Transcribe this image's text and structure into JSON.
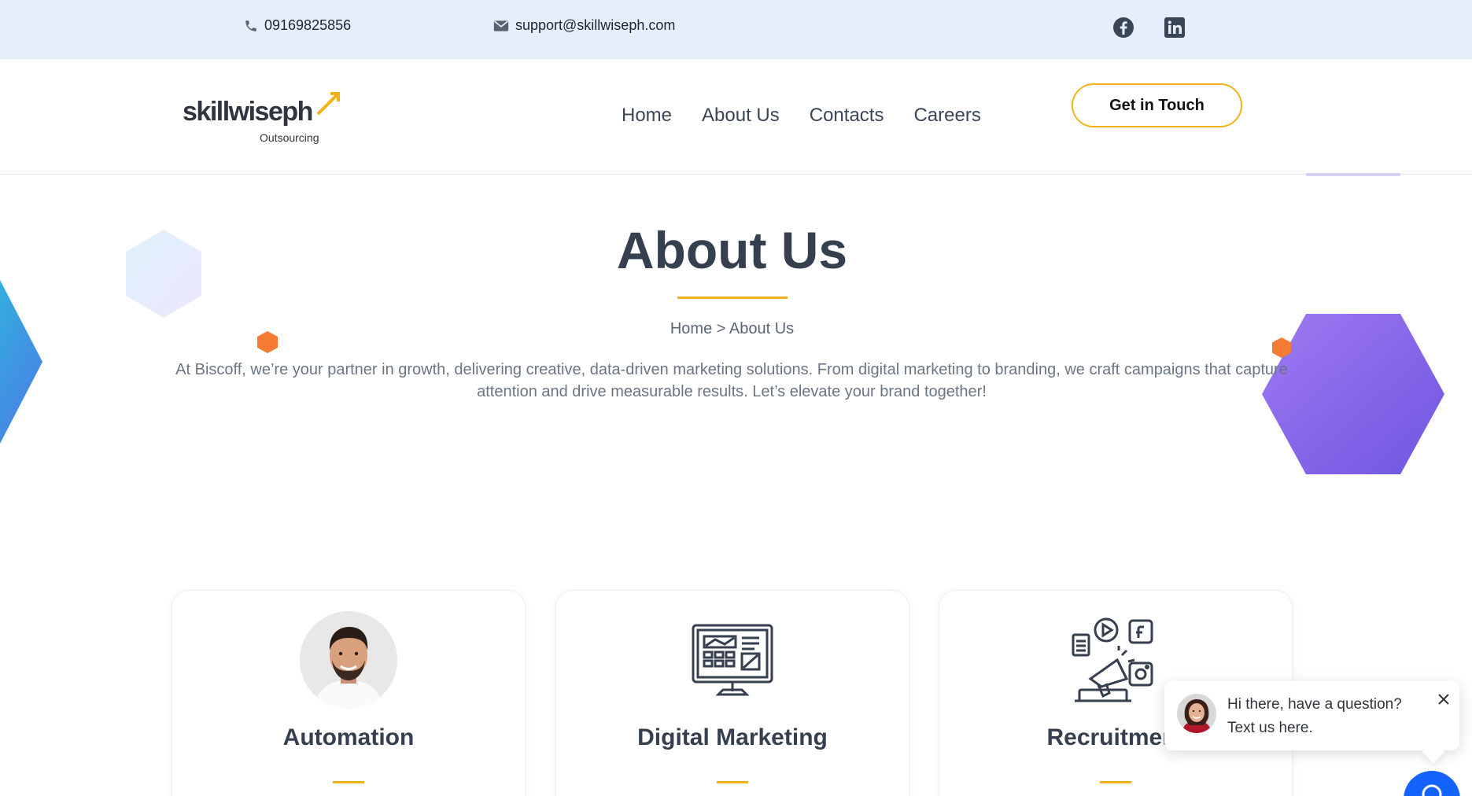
{
  "topbar": {
    "phone": "09169825856",
    "email": "support@skillwiseph.com",
    "social": [
      "facebook-icon",
      "linkedin-icon"
    ]
  },
  "header": {
    "logo_word": "skillwiseph",
    "logo_sub": "Outsourcing",
    "nav": [
      "Home",
      "About Us",
      "Contacts",
      "Careers"
    ],
    "cta_label": "Get in Touch"
  },
  "hero": {
    "title": "About Us",
    "breadcrumb": "Home > About Us",
    "intro": "At Biscoff, we’re your partner in growth, delivering creative, data-driven marketing solutions. From digital marketing to branding, we craft campaigns that capture attention and drive measurable results. Let’s elevate your brand together!"
  },
  "cards": [
    {
      "title": "Automation",
      "icon": "person-avatar"
    },
    {
      "title": "Digital Marketing",
      "icon": "dashboard-monitor-icon"
    },
    {
      "title": "Recruitment",
      "icon": "megaphone-social-icon"
    }
  ],
  "chat": {
    "line1": "Hi there, have a question?",
    "line2": "Text us here."
  },
  "colors": {
    "accent": "#f2b21b",
    "text_dark": "#353f4f",
    "topbar_bg": "#e7eefb",
    "purple": "#7a62e8",
    "orange": "#f57a32",
    "chat_blue": "#1463ff"
  }
}
